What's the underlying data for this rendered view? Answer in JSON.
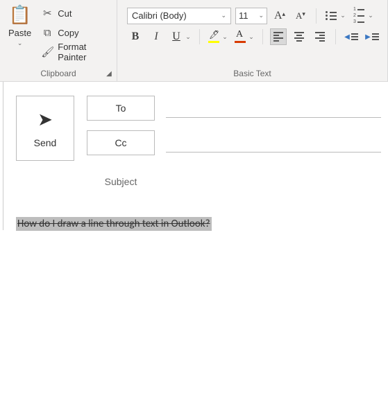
{
  "ribbon": {
    "clipboard": {
      "label": "Clipboard",
      "paste": "Paste",
      "cut": "Cut",
      "copy": "Copy",
      "format_painter": "Format Painter"
    },
    "basic_text": {
      "label": "Basic Text",
      "font_name": "Calibri (Body)",
      "font_size": "11"
    }
  },
  "compose": {
    "send": "Send",
    "to": "To",
    "cc": "Cc",
    "subject_label": "Subject",
    "to_value": "",
    "cc_value": "",
    "subject_value": ""
  },
  "body": {
    "line1": "How do I draw a line through text in Outlook?"
  }
}
